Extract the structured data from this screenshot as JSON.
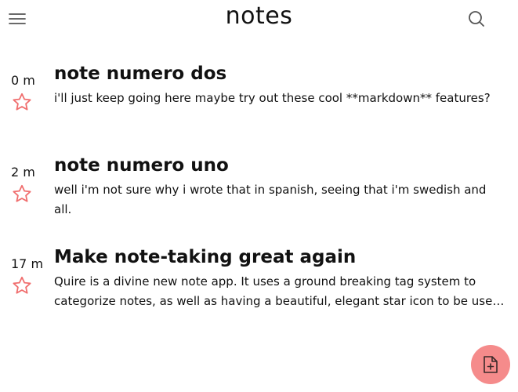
{
  "header": {
    "title": "notes",
    "menu_icon": "hamburger-menu-icon",
    "search_icon": "search-icon"
  },
  "notes": [
    {
      "age": "0 m",
      "title": "note numero dos",
      "body": "i'll just keep going here maybe try out these cool **markdown** features?",
      "starred": false
    },
    {
      "age": "2 m",
      "title": "note numero uno",
      "body": "well i'm not sure why i wrote that in spanish, seeing that i'm swedish and all.",
      "starred": false
    },
    {
      "age": "17 m",
      "title": "Make note-taking great again",
      "body": "Quire is a divine new note app. It uses a ground breaking tag system to categorize notes, as well as having a beautiful, elegant star icon to be used for favouriting notes.",
      "starred": false
    }
  ],
  "fab": {
    "icon": "new-note-icon"
  },
  "colors": {
    "accent": "#f58b8b",
    "star_outline": "#f06e6e",
    "text": "#111111"
  }
}
